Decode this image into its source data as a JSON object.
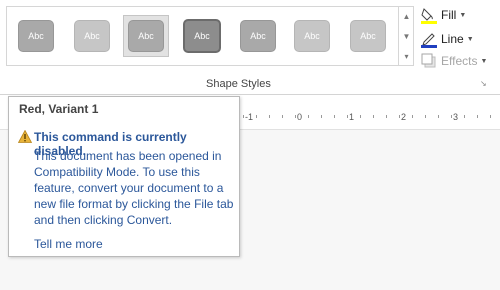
{
  "ribbon": {
    "gallery_items": [
      {
        "label": "Abc"
      },
      {
        "label": "Abc"
      },
      {
        "label": "Abc"
      },
      {
        "label": "Abc"
      },
      {
        "label": "Abc"
      },
      {
        "label": "Abc"
      },
      {
        "label": "Abc"
      }
    ],
    "commands": {
      "fill_label": "Fill",
      "line_label": "Line",
      "effects_label": "Effects"
    },
    "group_label": "Shape Styles"
  },
  "ruler": {
    "numbers": [
      "-1",
      "0",
      "1",
      "2",
      "3"
    ]
  },
  "tooltip": {
    "title": "Red, Variant 1",
    "heading": "This command is currently disabled.",
    "body_lines": [
      "This document has been opened in",
      "Compatibility Mode. To use this",
      "feature, convert your document to a",
      "new file format by clicking the File tab",
      "and then clicking Convert."
    ],
    "link": "Tell me more"
  },
  "colors": {
    "accent_text": "#2b579a",
    "fill_underline": "#ffff00",
    "line_underline": "#1f3fbf",
    "warning": "#e8b339"
  }
}
